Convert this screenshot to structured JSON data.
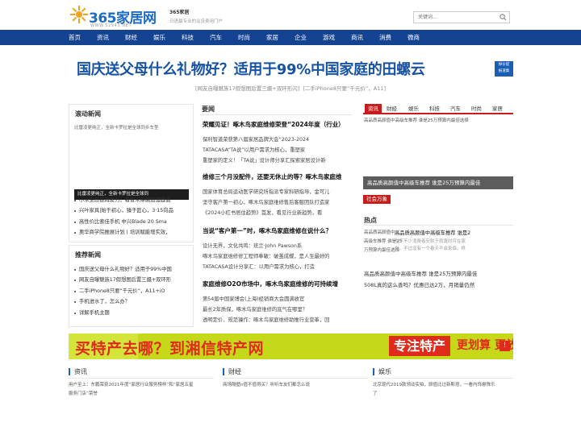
{
  "header": {
    "logo_text": "365家居网",
    "logo_url": "WWW.52943.NET",
    "site_name": "365家居",
    "slogan": "日语最专业的业设费用门户",
    "search_placeholder": "关键词..."
  },
  "nav": [
    "首页",
    "资讯",
    "财经",
    "娱乐",
    "科技",
    "汽车",
    "时尚",
    "家居",
    "企业",
    "游戏",
    "商讯",
    "消费",
    "微商"
  ],
  "headline": {
    "title": "国庆送父母什么礼物好？适用于99%中国家庭的田螺云",
    "tip": [
      "掉价提",
      "报道集"
    ],
    "subs": [
      "[网友自曝魅族17假想图后置三摄+双环形闪]",
      "[二手iPhone8只要“千元价”，A11]"
    ]
  },
  "scroll_news": {
    "title": "滚动新闻",
    "image_alt": "比雷凌更纯正，全新卡罗拉是全球同步车型",
    "caption": "比雷凌更纯正，全新卡罗拉是全球同",
    "items": [
      "小米生态链再发力，看智米除菌加湿器值",
      "兴叶家具|始于初心，臻于匠心，3·15向品",
      "高性价比索佳手机 中兴Blade 20 Sma",
      "奥华商学院推展计划丨培训赋能增实效，"
    ]
  },
  "recommend": {
    "title": "推荐新闻",
    "items": [
      "国庆送父母什么礼物好？适用于99%中国",
      "网友自曝魅族17假想图后置三摄+双环形",
      "二手iPhone8只要“千元价”，A11+iO",
      "手机进水了，怎么办？",
      "详解手机主题"
    ]
  },
  "important": {
    "title": "要闻",
    "articles": [
      {
        "title": "荣耀见证！啄木鸟家庭维修荣登“2024年度（行业）",
        "lines": [
          "保利智道荣获第八届家居品牌大会“2023-2024",
          "TATACASA“TA说”以用户需求为核心，重塑家",
          "重塑家的定义！「TA说」设计师分享汇探索家居设计新"
        ]
      },
      {
        "title": "维修三个月没配件，还要无休止的等？啄木鸟家庭维",
        "lines": [
          "国家体育总局运动医学研究所指派专家科研指导，金可儿",
          "坚守客户第一初心，啄木鸟家庭维修售后客服团队打造家",
          "《2024小红书居住趋势》首发，看见行业新趋势，看"
        ]
      },
      {
        "title": "当说“客户第一”时，啄木鸟家庭维修在说什么？",
        "lines": [
          "设计无界，文化共鸣：班兰·John Pawson系",
          "啄木鸟家庭维修修工程师奉敏：破茧成蝶，是人生最好的",
          "TATACASA设计分享汇：以用户需求为核心，打造"
        ]
      },
      {
        "title": "家庭维修O2O市场中，啄木鸟家庭维修的可持续增",
        "lines": [
          "第54届中国家博会(上海)经销商大会圆满收官",
          "最长2年质保，啄木鸟家庭维修的底气在哪里？",
          "透明定价、规范操作：啄木鸟家庭维修助推行业变革，回"
        ]
      }
    ]
  },
  "right": {
    "tabs": [
      "资讯",
      "财经",
      "娱乐",
      "科技",
      "汽车",
      "时尚",
      "家居"
    ],
    "active_tab": "资讯",
    "image_alt": "高品质高颜值中高级车推荐 谁是25万预算内最佳选择",
    "bar_text": "高品质高颜值中高级车推荐 谁是25万预算内最佳",
    "social_tag": "社会万象",
    "hot_title": "热点",
    "hot_image_alt": [
      "高品质高颜值中",
      "高级车推荐 谁是25",
      "万预算内最佳选择"
    ],
    "hot_article_title": "高品质高颜值中高级车推荐 谁是2",
    "hot_article_desc": [
      "当下不少消费者安耐于寂寞时可在家",
      "中，不过没有一个春天不会来临，终"
    ],
    "list": [
      "高品质高颜值中高级车推荐 谁是25万预算内最佳",
      "508L真的这么香吗？优惠已达2万，月销量仍然"
    ]
  },
  "banner": {
    "main": "买特产去哪？到湘信特产网",
    "box": "专注特产",
    "right": "更划算 更放心",
    "mark": "!"
  },
  "bottom": [
    {
      "title": "资讯",
      "img_alt": [
        "用户至上：东鹏荣获2021年度“家居行业服务榜样”和“家居五星",
        "服务门店”荣誉"
      ]
    },
    {
      "title": "财经",
      "img_alt": [
        "商场隔壁n值不值得买？听听车友们都怎么说"
      ]
    },
    {
      "title": "娱乐",
      "img_alt": [
        "北京现代2019款领动实拍，颜值比过新斯塔，一看内饰悬殊乐",
        "了"
      ]
    }
  ],
  "colors": {
    "nav": "#134391",
    "accent": "#c81c1c",
    "headline": "#1753a5",
    "banner": "#c6d81a"
  }
}
